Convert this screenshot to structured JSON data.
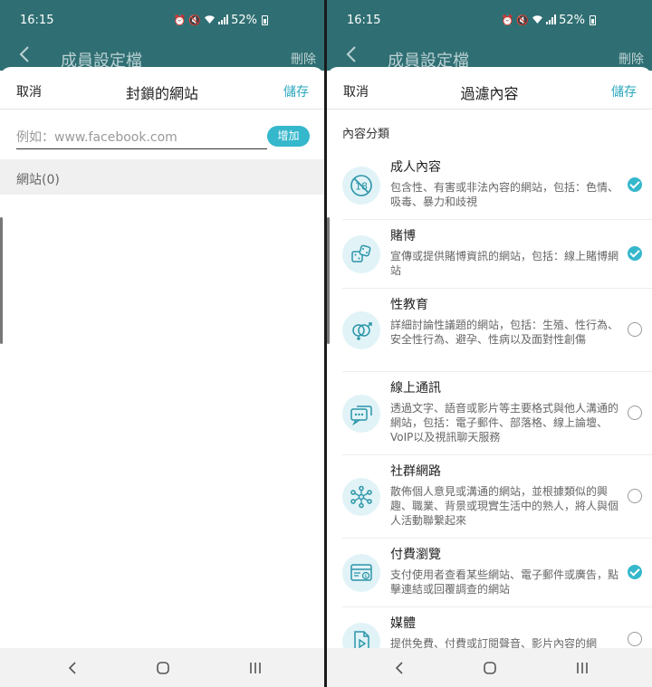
{
  "status_bar": {
    "time": "16:15",
    "battery": "52%"
  },
  "app_header": {
    "title": "成員設定檔",
    "delete_label": "刪除"
  },
  "blocked_sites": {
    "cancel_label": "取消",
    "title": "封鎖的網站",
    "save_label": "儲存",
    "url_placeholder": "例如：www.facebook.com",
    "add_label": "增加",
    "sites_header": "網站(0)"
  },
  "content_filter": {
    "cancel_label": "取消",
    "title": "過濾內容",
    "save_label": "儲存",
    "section_label": "內容分類",
    "categories": [
      {
        "name": "成人內容",
        "desc": "包含性、有害或非法內容的網站，包括：色情、吸毒、暴力和歧視",
        "checked": true,
        "icon": "age-18-icon"
      },
      {
        "name": "賭博",
        "desc": "宣傳或提供賭博資訊的網站，包括：線上賭博網站",
        "checked": true,
        "icon": "dice-icon"
      },
      {
        "name": "性教育",
        "desc": "詳細討論性議題的網站，包括：生殖、性行為、安全性行為、避孕、性病以及面對性創傷",
        "checked": false,
        "icon": "gender-icon"
      },
      {
        "name": "線上通訊",
        "desc": "透過文字、語音或影片等主要格式與他人溝通的網站，包括：電子郵件、部落格、線上論壇、VoIP以及視訊聊天服務",
        "checked": false,
        "icon": "chat-icon"
      },
      {
        "name": "社群網路",
        "desc": "散佈個人意見或溝通的網站，並根據類似的興趣、職業、背景或現實生活中的熟人，將人與個人活動聯繫起來",
        "checked": false,
        "icon": "network-icon"
      },
      {
        "name": "付費瀏覽",
        "desc": "支付使用者查看某些網站、電子郵件或廣告，點擊連結或回覆調查的網站",
        "checked": true,
        "icon": "paid-browser-icon"
      },
      {
        "name": "媒體",
        "desc": "提供免費、付費或訂閱聲音、影片內容的網",
        "checked": false,
        "icon": "media-file-icon"
      }
    ]
  },
  "colors": {
    "accent": "#35b7cc",
    "header_bg": "#2f6f73"
  }
}
